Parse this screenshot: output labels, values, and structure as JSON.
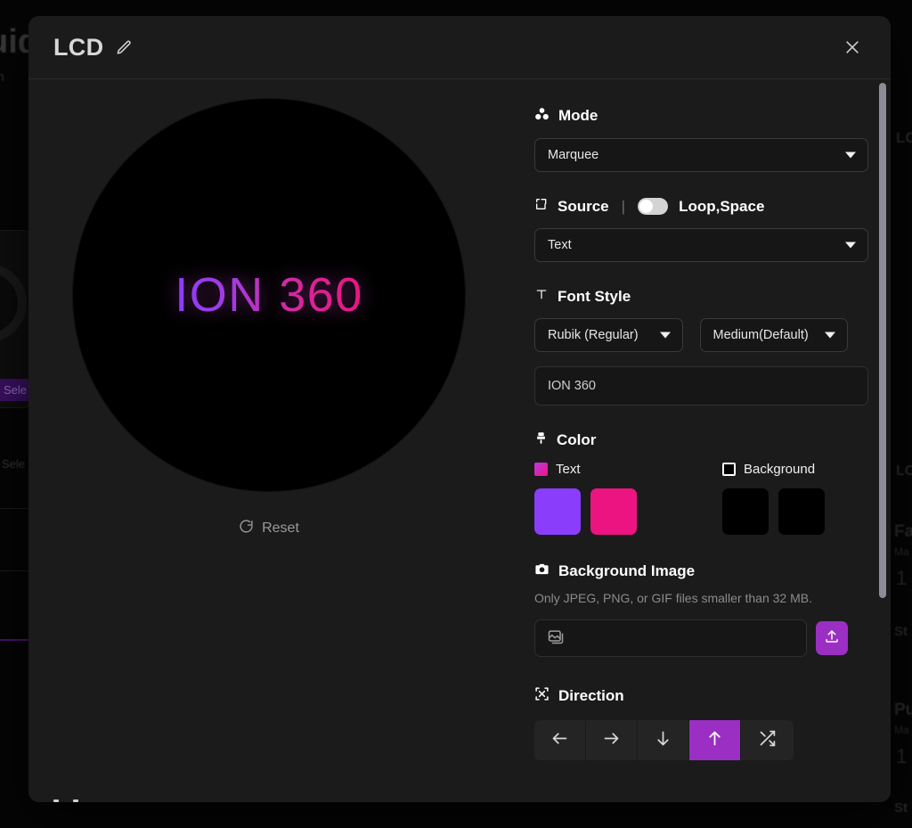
{
  "background": {
    "left_title": "uid",
    "left_sub": "on",
    "chip": "Sele",
    "chip2": "Sele",
    "right_labels": [
      "LC",
      "LC",
      "Fa",
      "Ma",
      "1",
      "St",
      "Pu",
      "Ma",
      "1",
      "St"
    ]
  },
  "modal": {
    "title": "LCD",
    "edit_icon": "pencil-icon",
    "close_icon": "close-icon"
  },
  "preview": {
    "text": "ION 360",
    "reset_label": "Reset",
    "reset_icon": "reset-icon",
    "gradient_start": "#8b3dfc",
    "gradient_end": "#ec1480",
    "background_color": "#000000"
  },
  "controls": {
    "mode": {
      "icon": "shapes-icon",
      "label": "Mode",
      "value": "Marquee"
    },
    "source": {
      "icon": "source-icon",
      "label": "Source",
      "separator": "|",
      "toggle_label": "Loop,Space",
      "toggle_on": true,
      "value": "Text"
    },
    "font_style": {
      "icon": "text-icon",
      "label": "Font Style",
      "family": "Rubik (Regular)",
      "size": "Medium(Default)",
      "text_value": "ION 360",
      "text_placeholder": "ION 360"
    },
    "color": {
      "icon": "brush-icon",
      "label": "Color",
      "text_label": "Text",
      "text_swatch_icon": "text-color-chip",
      "background_label": "Background",
      "background_swatch_icon": "background-color-chip",
      "text_swatches": [
        "#8b3dfc",
        "#ec1480"
      ],
      "background_swatches": [
        "#000000",
        "#000000"
      ]
    },
    "background_image": {
      "icon": "camera-icon",
      "label": "Background Image",
      "hint": "Only JPEG, PNG, or GIF files smaller than 32 MB.",
      "field_icon": "image-icon",
      "field_value": "",
      "upload_icon": "upload-icon"
    },
    "direction": {
      "icon": "direction-icon",
      "label": "Direction",
      "options": [
        {
          "name": "left",
          "icon": "arrow-left-icon",
          "selected": false
        },
        {
          "name": "right",
          "icon": "arrow-right-icon",
          "selected": false
        },
        {
          "name": "down",
          "icon": "arrow-down-icon",
          "selected": false
        },
        {
          "name": "up",
          "icon": "arrow-up-icon",
          "selected": true
        },
        {
          "name": "shuffle",
          "icon": "shuffle-icon",
          "selected": false
        }
      ],
      "accent_color": "#9b2fc4"
    }
  }
}
